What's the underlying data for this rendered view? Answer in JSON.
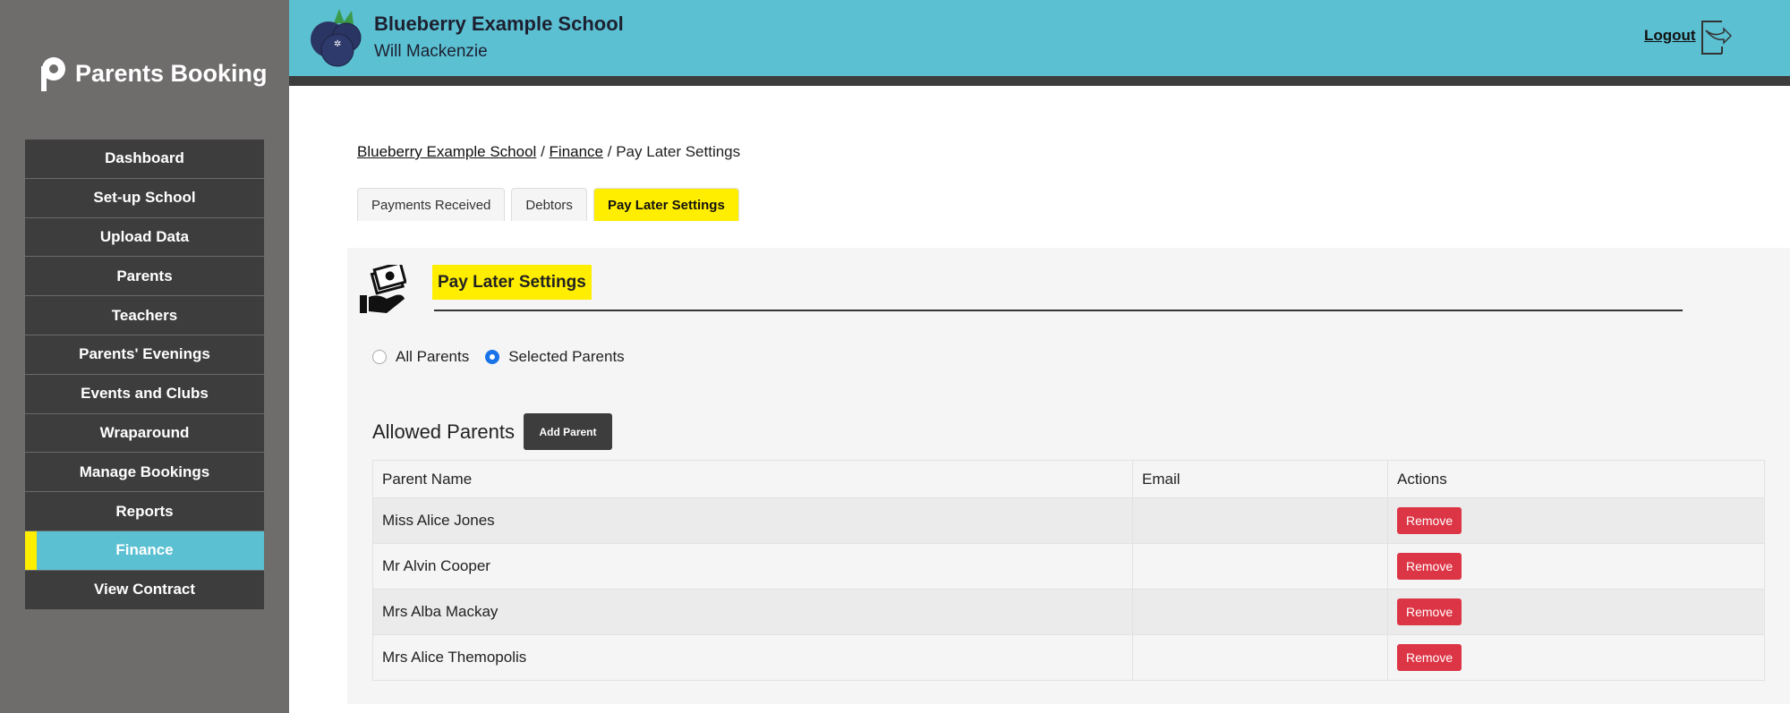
{
  "brand": "Parents Booking",
  "header": {
    "school": "Blueberry Example School",
    "user": "Will Mackenzie",
    "logout": "Logout"
  },
  "nav": [
    "Dashboard",
    "Set-up School",
    "Upload Data",
    "Parents",
    "Teachers",
    "Parents' Evenings",
    "Events and Clubs",
    "Wraparound",
    "Manage Bookings",
    "Reports",
    "Finance",
    "View Contract"
  ],
  "active_nav": "Finance",
  "breadcrumb": {
    "school": "Blueberry Example School",
    "finance": "Finance",
    "sep": "/",
    "current": "Pay Later Settings"
  },
  "tabs": [
    "Payments Received",
    "Debtors",
    "Pay Later Settings"
  ],
  "panel": {
    "title": "Pay Later Settings",
    "radio_all": "All Parents",
    "radio_selected": "Selected Parents",
    "selected": "Selected Parents",
    "allowed": "Allowed Parents",
    "add": "Add Parent"
  },
  "table": {
    "headers": [
      "Parent Name",
      "Email",
      "Actions"
    ],
    "rows": [
      {
        "name": "Miss Alice Jones",
        "email": "",
        "action": "Remove"
      },
      {
        "name": "Mr Alvin Cooper",
        "email": "",
        "action": "Remove"
      },
      {
        "name": "Mrs Alba Mackay",
        "email": "",
        "action": "Remove"
      },
      {
        "name": "Mrs Alice Themopolis",
        "email": "",
        "action": "Remove"
      }
    ]
  },
  "colors": {
    "accent": "#5bc0d2",
    "highlight": "#ffee00",
    "danger": "#dc3545"
  }
}
